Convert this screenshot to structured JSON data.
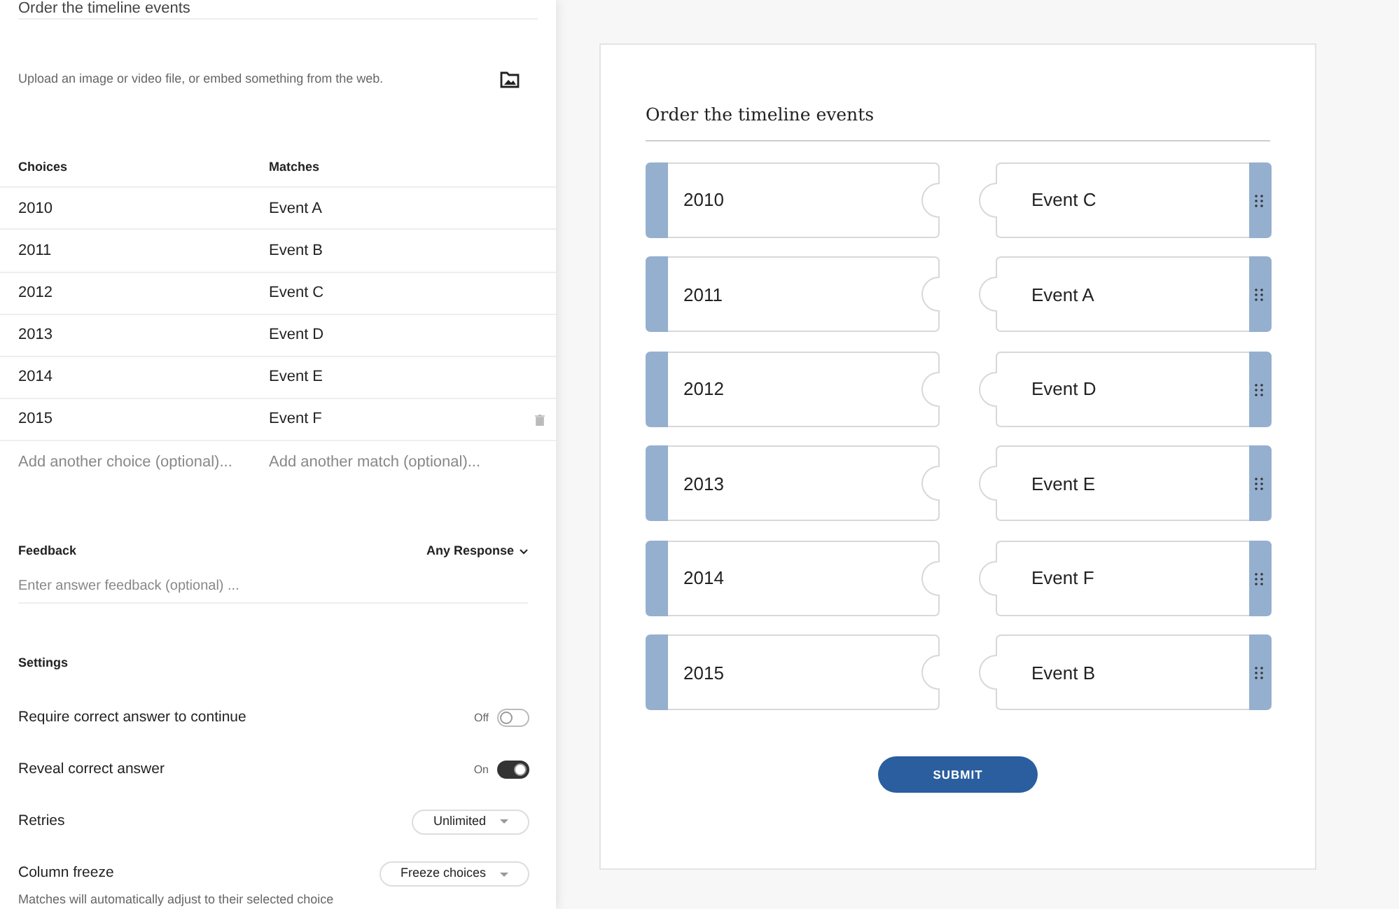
{
  "editor": {
    "question_title": "Order the timeline events",
    "media_hint": "Upload an image or video file, or embed something from the web.",
    "table": {
      "columns": [
        "Choices",
        "Matches"
      ],
      "rows": [
        {
          "choice": "2010",
          "match": "Event A",
          "hovered": false
        },
        {
          "choice": "2011",
          "match": "Event B",
          "hovered": false
        },
        {
          "choice": "2012",
          "match": "Event C",
          "hovered": false
        },
        {
          "choice": "2013",
          "match": "Event D",
          "hovered": false
        },
        {
          "choice": "2014",
          "match": "Event E",
          "hovered": false
        },
        {
          "choice": "2015",
          "match": "Event F",
          "hovered": true
        }
      ],
      "add_choice_placeholder": "Add another choice (optional)...",
      "add_match_placeholder": "Add another match (optional)..."
    },
    "feedback": {
      "label": "Feedback",
      "mode": "Any Response",
      "placeholder": "Enter answer feedback (optional) ..."
    },
    "settings": {
      "title": "Settings",
      "items": [
        {
          "kind": "toggle",
          "label": "Require correct answer to continue",
          "state_text": "Off",
          "on": false
        },
        {
          "kind": "toggle",
          "label": "Reveal correct answer",
          "state_text": "On",
          "on": true
        },
        {
          "kind": "select",
          "label": "Retries",
          "value": "Unlimited"
        },
        {
          "kind": "select",
          "label": "Column freeze",
          "value": "Freeze choices"
        }
      ],
      "note": "Matches will automatically adjust to their selected choice"
    }
  },
  "preview": {
    "title": "Order the timeline events",
    "pairs": [
      {
        "choice": "2010",
        "match": "Event C"
      },
      {
        "choice": "2011",
        "match": "Event A"
      },
      {
        "choice": "2012",
        "match": "Event D"
      },
      {
        "choice": "2013",
        "match": "Event E"
      },
      {
        "choice": "2014",
        "match": "Event F"
      },
      {
        "choice": "2015",
        "match": "Event B"
      }
    ],
    "submit": "SUBMIT"
  }
}
